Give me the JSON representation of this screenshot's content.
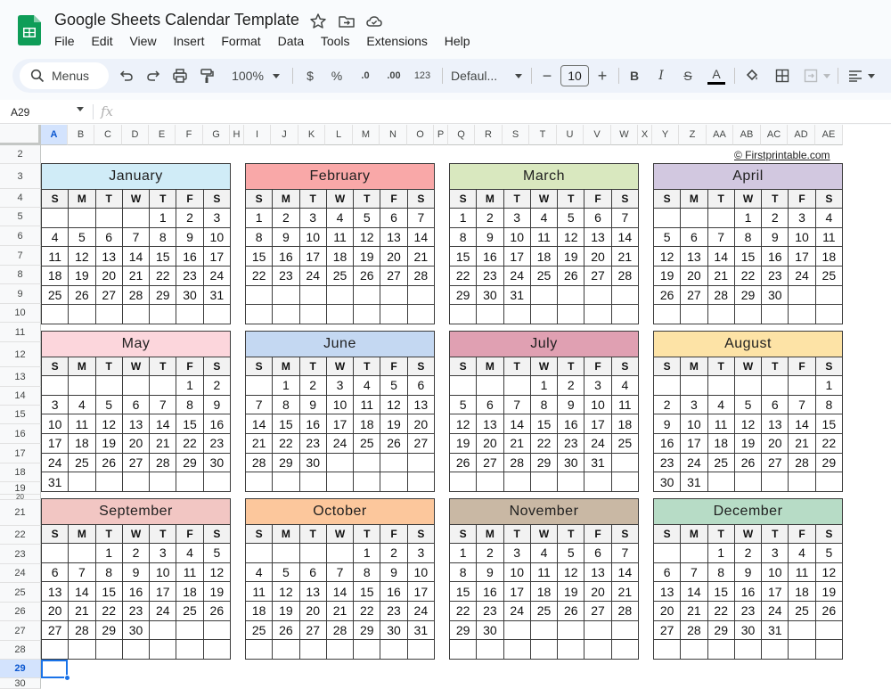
{
  "app": {
    "doc_title": "Google Sheets Calendar Template",
    "menu": [
      "File",
      "Edit",
      "View",
      "Insert",
      "Format",
      "Data",
      "Tools",
      "Extensions",
      "Help"
    ]
  },
  "toolbar": {
    "search_label": "Menus",
    "zoom": "100%",
    "currency": "$",
    "percent": "%",
    "dec_decrease": ".0",
    "dec_increase": ".00",
    "number_format": "123",
    "font_name": "Defaul...",
    "font_size": "10",
    "minus": "−",
    "plus": "+",
    "bold": "B",
    "italic": "I",
    "strike": "S",
    "text_color_letter": "A"
  },
  "formula_bar": {
    "cell_ref": "A29",
    "fx_label": "fx"
  },
  "grid": {
    "columns": [
      "A",
      "B",
      "C",
      "D",
      "E",
      "F",
      "G",
      "H",
      "I",
      "J",
      "K",
      "L",
      "M",
      "N",
      "O",
      "P",
      "Q",
      "R",
      "S",
      "T",
      "U",
      "V",
      "W",
      "X",
      "Y",
      "Z",
      "AA",
      "AB",
      "AC",
      "AD",
      "AE"
    ],
    "rows": [
      "2",
      "3",
      "4",
      "5",
      "6",
      "7",
      "8",
      "9",
      "10",
      "11",
      "12",
      "13",
      "14",
      "15",
      "16",
      "17",
      "18",
      "19",
      "20",
      "21",
      "22",
      "23",
      "24",
      "25",
      "26",
      "27",
      "28",
      "29",
      "30"
    ],
    "selected_col": "A",
    "selected_row": "29",
    "credit": "© Firstprintable.com"
  },
  "calendar": {
    "weekdays": [
      "S",
      "M",
      "T",
      "W",
      "T",
      "F",
      "S"
    ],
    "months": [
      {
        "name": "January",
        "color": "#d0ecf7",
        "weeks": [
          [
            "",
            "",
            "",
            "",
            "1",
            "2",
            "3"
          ],
          [
            "4",
            "5",
            "6",
            "7",
            "8",
            "9",
            "10"
          ],
          [
            "11",
            "12",
            "13",
            "14",
            "15",
            "16",
            "17"
          ],
          [
            "18",
            "19",
            "20",
            "21",
            "22",
            "23",
            "24"
          ],
          [
            "25",
            "26",
            "27",
            "28",
            "29",
            "30",
            "31"
          ],
          [
            "",
            "",
            "",
            "",
            "",
            "",
            ""
          ]
        ]
      },
      {
        "name": "February",
        "color": "#f9a8a8",
        "weeks": [
          [
            "1",
            "2",
            "3",
            "4",
            "5",
            "6",
            "7"
          ],
          [
            "8",
            "9",
            "10",
            "11",
            "12",
            "13",
            "14"
          ],
          [
            "15",
            "16",
            "17",
            "18",
            "19",
            "20",
            "21"
          ],
          [
            "22",
            "23",
            "24",
            "25",
            "26",
            "27",
            "28"
          ],
          [
            "",
            "",
            "",
            "",
            "",
            "",
            ""
          ],
          [
            "",
            "",
            "",
            "",
            "",
            "",
            ""
          ]
        ]
      },
      {
        "name": "March",
        "color": "#d9e8bf",
        "weeks": [
          [
            "1",
            "2",
            "3",
            "4",
            "5",
            "6",
            "7"
          ],
          [
            "8",
            "9",
            "10",
            "11",
            "12",
            "13",
            "14"
          ],
          [
            "15",
            "16",
            "17",
            "18",
            "19",
            "20",
            "21"
          ],
          [
            "22",
            "23",
            "24",
            "25",
            "26",
            "27",
            "28"
          ],
          [
            "29",
            "30",
            "31",
            "",
            "",
            "",
            ""
          ],
          [
            "",
            "",
            "",
            "",
            "",
            "",
            ""
          ]
        ]
      },
      {
        "name": "April",
        "color": "#d2c8e0",
        "weeks": [
          [
            "",
            "",
            "",
            "1",
            "2",
            "3",
            "4"
          ],
          [
            "5",
            "6",
            "7",
            "8",
            "9",
            "10",
            "11"
          ],
          [
            "12",
            "13",
            "14",
            "15",
            "16",
            "17",
            "18"
          ],
          [
            "19",
            "20",
            "21",
            "22",
            "23",
            "24",
            "25"
          ],
          [
            "26",
            "27",
            "28",
            "29",
            "30",
            "",
            ""
          ],
          [
            "",
            "",
            "",
            "",
            "",
            "",
            ""
          ]
        ]
      },
      {
        "name": "May",
        "color": "#fcd6dc",
        "weeks": [
          [
            "",
            "",
            "",
            "",
            "",
            "1",
            "2"
          ],
          [
            "3",
            "4",
            "5",
            "6",
            "7",
            "8",
            "9"
          ],
          [
            "10",
            "11",
            "12",
            "13",
            "14",
            "15",
            "16"
          ],
          [
            "17",
            "18",
            "19",
            "20",
            "21",
            "22",
            "23"
          ],
          [
            "24",
            "25",
            "26",
            "27",
            "28",
            "29",
            "30"
          ],
          [
            "31",
            "",
            "",
            "",
            "",
            "",
            ""
          ]
        ]
      },
      {
        "name": "June",
        "color": "#c4d8f2",
        "weeks": [
          [
            "",
            "1",
            "2",
            "3",
            "4",
            "5",
            "6"
          ],
          [
            "7",
            "8",
            "9",
            "10",
            "11",
            "12",
            "13"
          ],
          [
            "14",
            "15",
            "16",
            "17",
            "18",
            "19",
            "20"
          ],
          [
            "21",
            "22",
            "23",
            "24",
            "25",
            "26",
            "27"
          ],
          [
            "28",
            "29",
            "30",
            "",
            "",
            "",
            ""
          ],
          [
            "",
            "",
            "",
            "",
            "",
            "",
            ""
          ]
        ]
      },
      {
        "name": "July",
        "color": "#e0a0b2",
        "weeks": [
          [
            "",
            "",
            "",
            "1",
            "2",
            "3",
            "4"
          ],
          [
            "5",
            "6",
            "7",
            "8",
            "9",
            "10",
            "11"
          ],
          [
            "12",
            "13",
            "14",
            "15",
            "16",
            "17",
            "18"
          ],
          [
            "19",
            "20",
            "21",
            "22",
            "23",
            "24",
            "25"
          ],
          [
            "26",
            "27",
            "28",
            "29",
            "30",
            "31",
            ""
          ],
          [
            "",
            "",
            "",
            "",
            "",
            "",
            ""
          ]
        ]
      },
      {
        "name": "August",
        "color": "#fde3a6",
        "weeks": [
          [
            "",
            "",
            "",
            "",
            "",
            "",
            "1"
          ],
          [
            "2",
            "3",
            "4",
            "5",
            "6",
            "7",
            "8"
          ],
          [
            "9",
            "10",
            "11",
            "12",
            "13",
            "14",
            "15"
          ],
          [
            "16",
            "17",
            "18",
            "19",
            "20",
            "21",
            "22"
          ],
          [
            "23",
            "24",
            "25",
            "26",
            "27",
            "28",
            "29"
          ],
          [
            "30",
            "31",
            "",
            "",
            "",
            "",
            ""
          ]
        ]
      },
      {
        "name": "September",
        "color": "#f2c6c3",
        "weeks": [
          [
            "",
            "",
            "1",
            "2",
            "3",
            "4",
            "5"
          ],
          [
            "6",
            "7",
            "8",
            "9",
            "10",
            "11",
            "12"
          ],
          [
            "13",
            "14",
            "15",
            "16",
            "17",
            "18",
            "19"
          ],
          [
            "20",
            "21",
            "22",
            "23",
            "24",
            "25",
            "26"
          ],
          [
            "27",
            "28",
            "29",
            "30",
            "",
            "",
            ""
          ],
          [
            "",
            "",
            "",
            "",
            "",
            "",
            ""
          ]
        ]
      },
      {
        "name": "October",
        "color": "#fcc79c",
        "weeks": [
          [
            "",
            "",
            "",
            "",
            "1",
            "2",
            "3"
          ],
          [
            "4",
            "5",
            "6",
            "7",
            "8",
            "9",
            "10"
          ],
          [
            "11",
            "12",
            "13",
            "14",
            "15",
            "16",
            "17"
          ],
          [
            "18",
            "19",
            "20",
            "21",
            "22",
            "23",
            "24"
          ],
          [
            "25",
            "26",
            "27",
            "28",
            "29",
            "30",
            "31"
          ],
          [
            "",
            "",
            "",
            "",
            "",
            "",
            ""
          ]
        ]
      },
      {
        "name": "November",
        "color": "#c9b8a4",
        "weeks": [
          [
            "1",
            "2",
            "3",
            "4",
            "5",
            "6",
            "7"
          ],
          [
            "8",
            "9",
            "10",
            "11",
            "12",
            "13",
            "14"
          ],
          [
            "15",
            "16",
            "17",
            "18",
            "19",
            "20",
            "21"
          ],
          [
            "22",
            "23",
            "24",
            "25",
            "26",
            "27",
            "28"
          ],
          [
            "29",
            "30",
            "",
            "",
            "",
            "",
            ""
          ],
          [
            "",
            "",
            "",
            "",
            "",
            "",
            ""
          ]
        ]
      },
      {
        "name": "December",
        "color": "#b7dcc6",
        "weeks": [
          [
            "",
            "",
            "1",
            "2",
            "3",
            "4",
            "5"
          ],
          [
            "6",
            "7",
            "8",
            "9",
            "10",
            "11",
            "12"
          ],
          [
            "13",
            "14",
            "15",
            "16",
            "17",
            "18",
            "19"
          ],
          [
            "20",
            "21",
            "22",
            "23",
            "24",
            "25",
            "26"
          ],
          [
            "27",
            "28",
            "29",
            "30",
            "31",
            "",
            ""
          ],
          [
            "",
            "",
            "",
            "",
            "",
            "",
            ""
          ]
        ]
      }
    ]
  }
}
